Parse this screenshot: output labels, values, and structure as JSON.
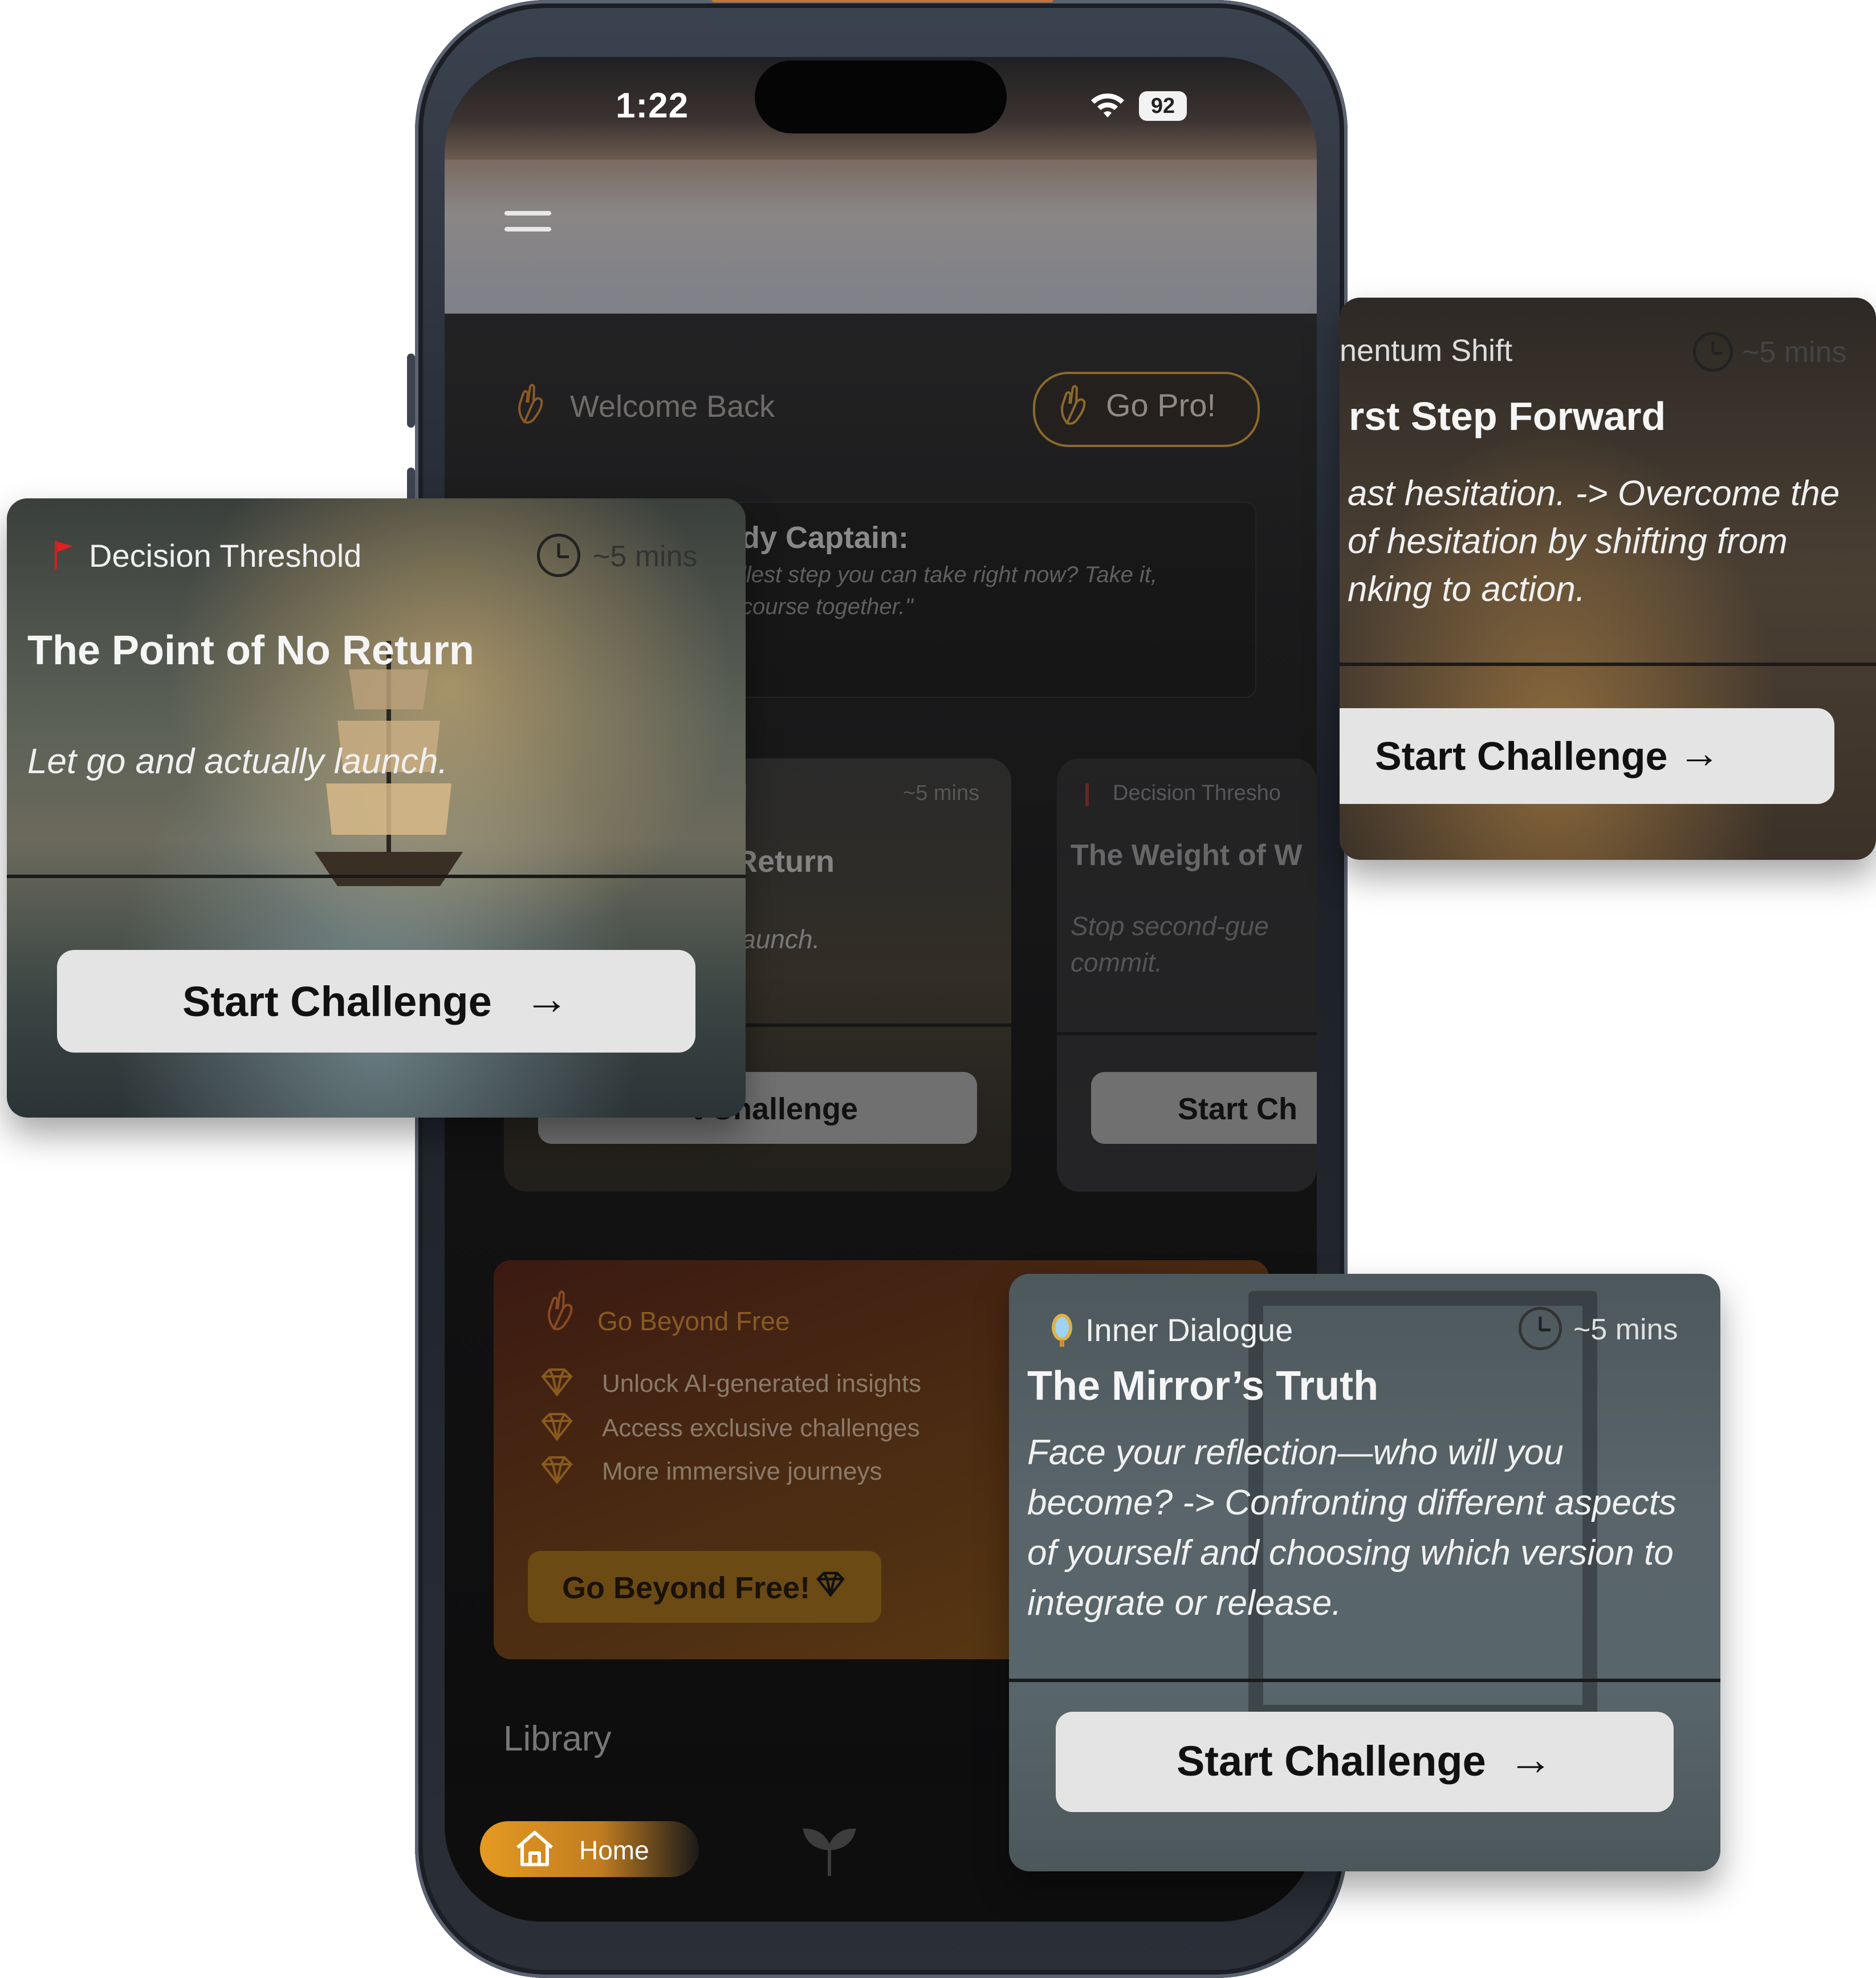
{
  "status": {
    "time": "1:22",
    "battery": "92"
  },
  "header": {
    "welcome": "Welcome Back",
    "go_pro": "Go Pro!"
  },
  "captain": {
    "title": "dy Captain:",
    "quote": "llest step you can take right now? Take it, course together.\""
  },
  "inner_cards": [
    {
      "category": "d",
      "time": "~5 mins",
      "title": "Return",
      "desc": "launch.",
      "button": "t Challenge"
    },
    {
      "category": "Decision Thresho",
      "time": "",
      "title": "The Weight of W",
      "desc": "Stop second-gue commit.",
      "button": "Start Ch"
    }
  ],
  "upsell": {
    "title": "Go Beyond Free",
    "items": [
      "Unlock AI-generated insights",
      "Access exclusive challenges",
      "More immersive journeys"
    ],
    "button": "Go Beyond Free!"
  },
  "library": {
    "label": "Library"
  },
  "tabbar": {
    "home": "Home"
  },
  "cards": {
    "left": {
      "category": "Decision Threshold",
      "time": "~5 mins",
      "title": "The Point of No Return",
      "desc": "Let go and actually launch.",
      "button": "Start Challenge"
    },
    "right": {
      "category": "nentum Shift",
      "time": "~5 mins",
      "title": "rst Step Forward",
      "desc": "ast hesitation. -> Overcome the of hesitation by shifting from nking to action.",
      "button": "Start Challenge"
    },
    "bottom": {
      "category": "Inner Dialogue",
      "time": "~5 mins",
      "title": "The Mirror’s Truth",
      "desc": "Face your reflection—who will you become? -> Confronting different aspects of yourself and choosing which version to integrate or release.",
      "button": "Start Challenge"
    }
  },
  "colors": {
    "accent": "#e69a22",
    "gold": "#6b4a14",
    "button_bg": "#e4e4e4"
  }
}
